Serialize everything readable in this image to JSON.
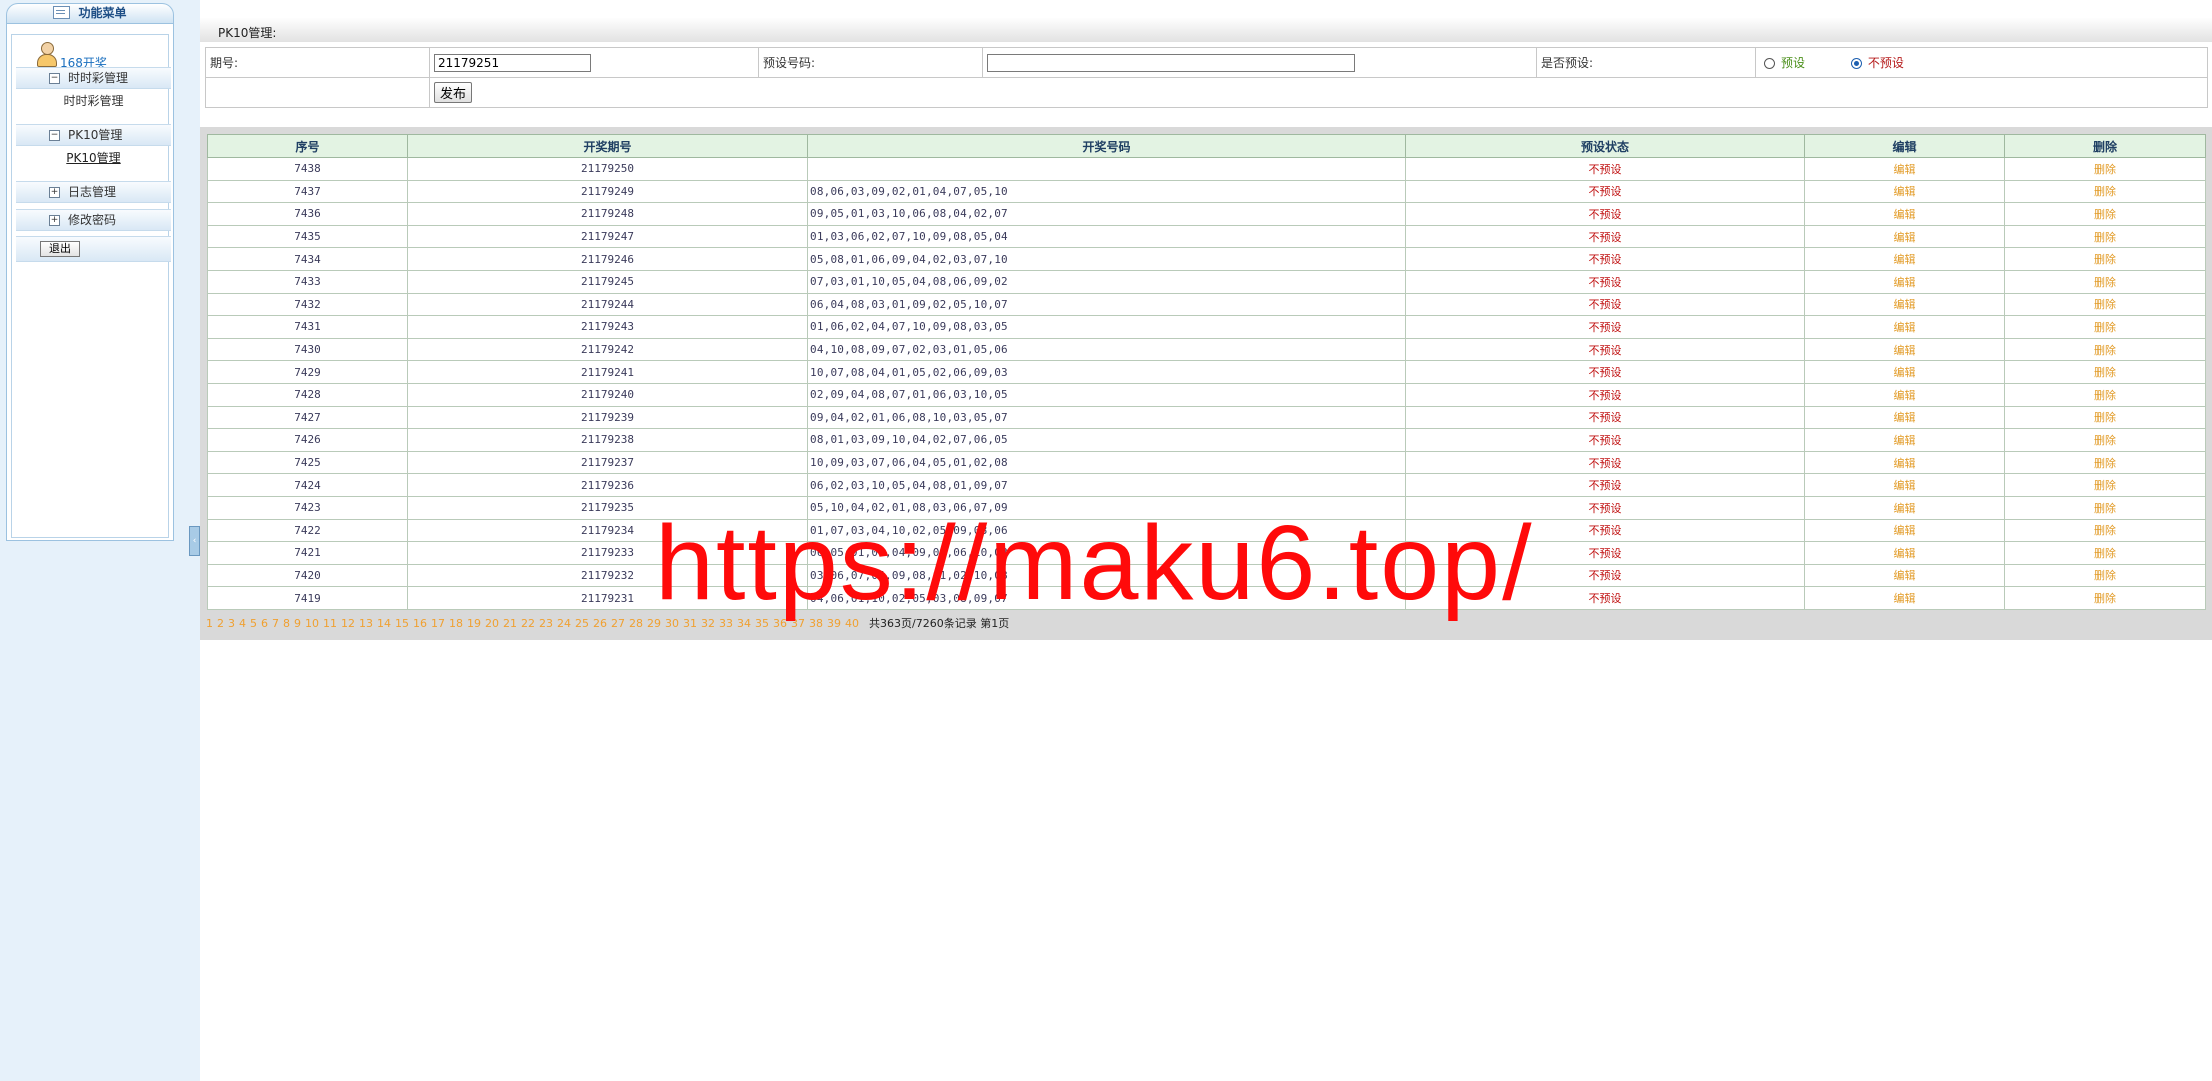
{
  "sidebar": {
    "header": "功能菜单",
    "user_name": "168开奖",
    "groups": [
      {
        "label": "时时彩管理",
        "toggle": "−",
        "item": "时时彩管理"
      },
      {
        "label": "PK10管理",
        "toggle": "−",
        "item": "PK10管理"
      },
      {
        "label": "日志管理",
        "toggle": "+"
      },
      {
        "label": "修改密码",
        "toggle": "+"
      }
    ],
    "logout": "退出"
  },
  "page": {
    "title": "PK10管理:",
    "form": {
      "period_label": "期号:",
      "period_value": "21179251",
      "preset_label": "预设号码:",
      "preset_value": "",
      "is_preset_label": "是否预设:",
      "opt_yes": "预设",
      "opt_no": "不预设",
      "selected": "不预设",
      "publish": "发布"
    },
    "table": {
      "headers": [
        "序号",
        "开奖期号",
        "开奖号码",
        "预设状态",
        "编辑",
        "删除"
      ],
      "rows": [
        [
          "7438",
          "21179250",
          "",
          "不预设",
          "编辑",
          "删除"
        ],
        [
          "7437",
          "21179249",
          "08,06,03,09,02,01,04,07,05,10",
          "不预设",
          "编辑",
          "删除"
        ],
        [
          "7436",
          "21179248",
          "09,05,01,03,10,06,08,04,02,07",
          "不预设",
          "编辑",
          "删除"
        ],
        [
          "7435",
          "21179247",
          "01,03,06,02,07,10,09,08,05,04",
          "不预设",
          "编辑",
          "删除"
        ],
        [
          "7434",
          "21179246",
          "05,08,01,06,09,04,02,03,07,10",
          "不预设",
          "编辑",
          "删除"
        ],
        [
          "7433",
          "21179245",
          "07,03,01,10,05,04,08,06,09,02",
          "不预设",
          "编辑",
          "删除"
        ],
        [
          "7432",
          "21179244",
          "06,04,08,03,01,09,02,05,10,07",
          "不预设",
          "编辑",
          "删除"
        ],
        [
          "7431",
          "21179243",
          "01,06,02,04,07,10,09,08,03,05",
          "不预设",
          "编辑",
          "删除"
        ],
        [
          "7430",
          "21179242",
          "04,10,08,09,07,02,03,01,05,06",
          "不预设",
          "编辑",
          "删除"
        ],
        [
          "7429",
          "21179241",
          "10,07,08,04,01,05,02,06,09,03",
          "不预设",
          "编辑",
          "删除"
        ],
        [
          "7428",
          "21179240",
          "02,09,04,08,07,01,06,03,10,05",
          "不预设",
          "编辑",
          "删除"
        ],
        [
          "7427",
          "21179239",
          "09,04,02,01,06,08,10,03,05,07",
          "不预设",
          "编辑",
          "删除"
        ],
        [
          "7426",
          "21179238",
          "08,01,03,09,10,04,02,07,06,05",
          "不预设",
          "编辑",
          "删除"
        ],
        [
          "7425",
          "21179237",
          "10,09,03,07,06,04,05,01,02,08",
          "不预设",
          "编辑",
          "删除"
        ],
        [
          "7424",
          "21179236",
          "06,02,03,10,05,04,08,01,09,07",
          "不预设",
          "编辑",
          "删除"
        ],
        [
          "7423",
          "21179235",
          "05,10,04,02,01,08,03,06,07,09",
          "不预设",
          "编辑",
          "删除"
        ],
        [
          "7422",
          "21179234",
          "01,07,03,04,10,02,05,09,08,06",
          "不预设",
          "编辑",
          "删除"
        ],
        [
          "7421",
          "21179233",
          "06,05,01,07,04,09,03,06,10,08",
          "不预设",
          "编辑",
          "删除"
        ],
        [
          "7420",
          "21179232",
          "03,06,07,04,09,08,01,02,10,08",
          "不预设",
          "编辑",
          "删除"
        ],
        [
          "7419",
          "21179231",
          "04,06,01,10,02,05,03,08,09,07",
          "不预设",
          "编辑",
          "删除"
        ]
      ]
    },
    "pager": {
      "pages": [
        "1",
        "2",
        "3",
        "4",
        "5",
        "6",
        "7",
        "8",
        "9",
        "10",
        "11",
        "12",
        "13",
        "14",
        "15",
        "16",
        "17",
        "18",
        "19",
        "20",
        "21",
        "22",
        "23",
        "24",
        "25",
        "26",
        "27",
        "28",
        "29",
        "30",
        "31",
        "32",
        "33",
        "34",
        "35",
        "36",
        "37",
        "38",
        "39",
        "40"
      ],
      "summary": "共363页/7260条记录 第1页"
    }
  },
  "watermark": "https://maku6.top/",
  "colors": {
    "sidebar_bg": "#e6f1fa",
    "header_bg": "#e3f3e3",
    "status_red": "#c01010",
    "action_orange": "#e29a24",
    "watermark_red": "#ff0a0a"
  }
}
